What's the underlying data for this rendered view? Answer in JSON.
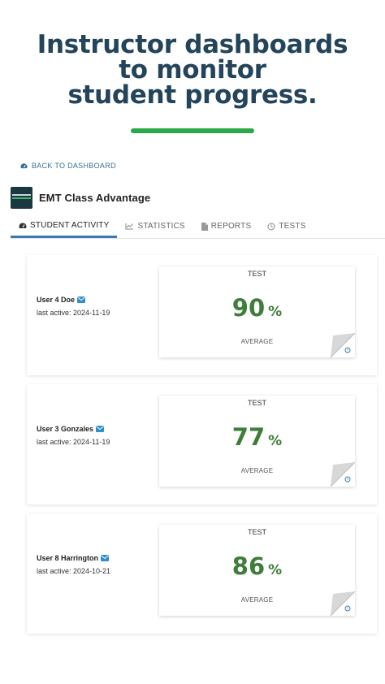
{
  "hero": {
    "line1": "Instructor dashboards",
    "line2": "to monitor",
    "line3": "student progress."
  },
  "nav": {
    "back_label": "BACK TO DASHBOARD"
  },
  "course": {
    "title": "EMT Class Advantage"
  },
  "tabs": [
    {
      "label": "STUDENT ACTIVITY",
      "icon": "gauge-icon",
      "active": true
    },
    {
      "label": "STATISTICS",
      "icon": "line-chart-icon"
    },
    {
      "label": "REPORTS",
      "icon": "document-icon"
    },
    {
      "label": "TESTS",
      "icon": "clock-icon"
    }
  ],
  "students": [
    {
      "name": "User 4 Doe",
      "last_active": "last active: 2024-11-19",
      "test_label": "TEST",
      "score": "90",
      "unit": "%",
      "score_label": "AVERAGE"
    },
    {
      "name": "User 3 Gonzales",
      "last_active": "last active: 2024-11-19",
      "test_label": "TEST",
      "score": "77",
      "unit": "%",
      "score_label": "AVERAGE"
    },
    {
      "name": "User 8 Harrington",
      "last_active": "last active: 2024-10-21",
      "test_label": "TEST",
      "score": "86",
      "unit": "%",
      "score_label": "AVERAGE"
    }
  ],
  "colors": {
    "accent": "#3a7ab3",
    "score": "#3f7d3a",
    "hero_bar": "#2ba84a",
    "hero_text": "#23445a"
  }
}
